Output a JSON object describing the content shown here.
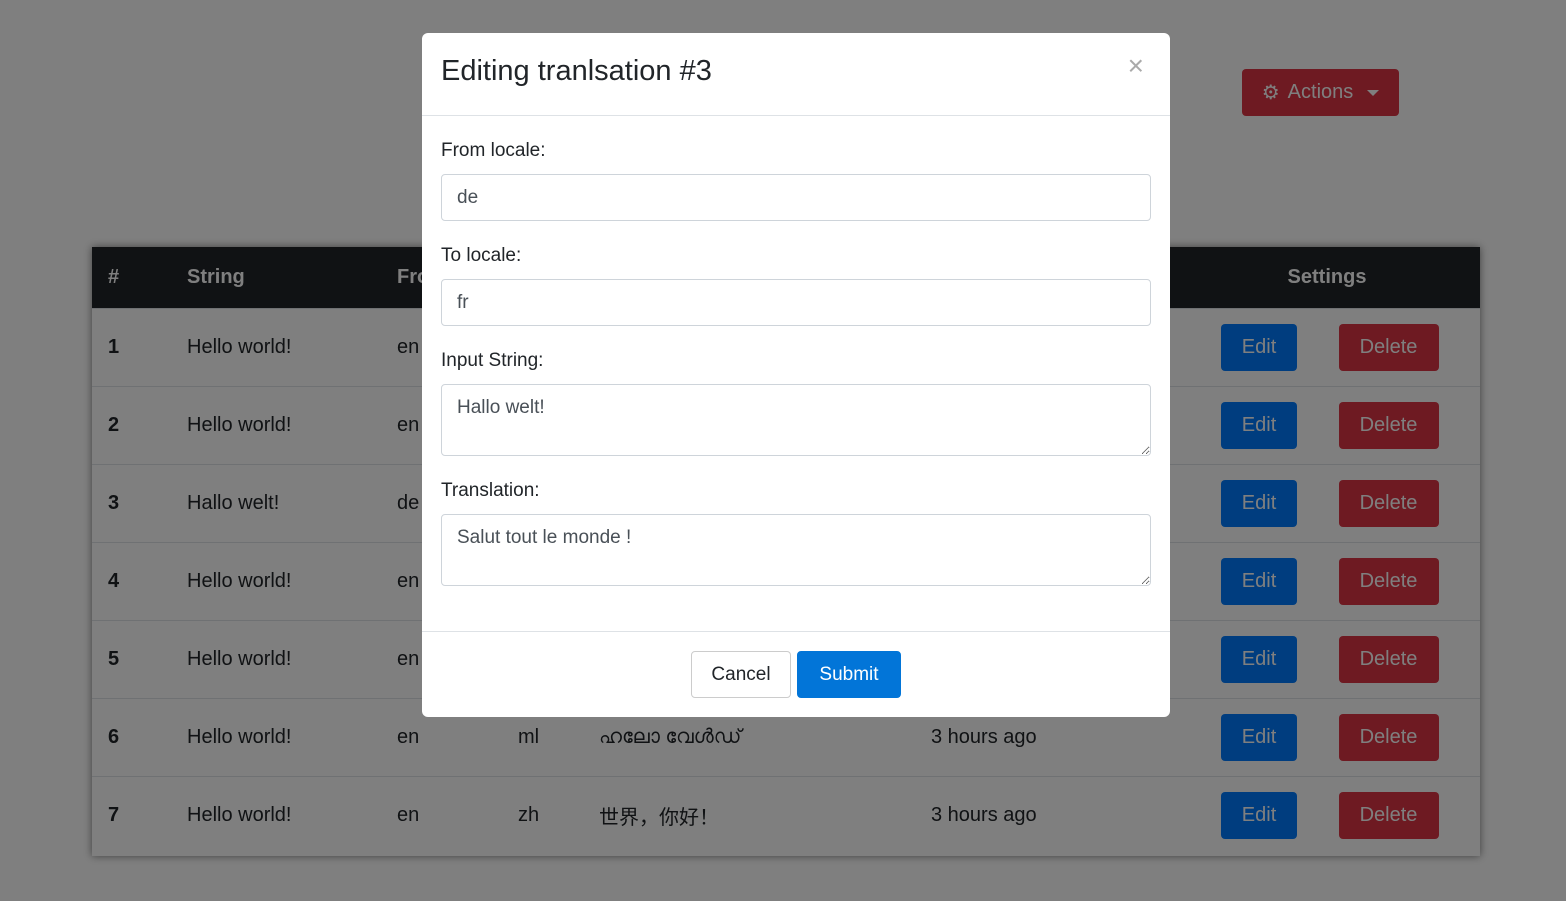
{
  "toolbar": {
    "actions_label": "Actions",
    "actions_icon": "gear-icon",
    "actions_color": "#dc3545"
  },
  "table": {
    "headers": [
      "#",
      "String",
      "From",
      "",
      "",
      "",
      "Settings"
    ],
    "rows": [
      {
        "id": "1",
        "string": "Hello world!",
        "from": "en",
        "to": "",
        "translation": "",
        "time": "",
        "edit": "Edit",
        "delete": "Delete"
      },
      {
        "id": "2",
        "string": "Hello world!",
        "from": "en",
        "to": "",
        "translation": "",
        "time": "",
        "edit": "Edit",
        "delete": "Delete"
      },
      {
        "id": "3",
        "string": "Hallo welt!",
        "from": "de",
        "to": "",
        "translation": "",
        "time": "",
        "edit": "Edit",
        "delete": "Delete"
      },
      {
        "id": "4",
        "string": "Hello world!",
        "from": "en",
        "to": "",
        "translation": "",
        "time": "",
        "edit": "Edit",
        "delete": "Delete"
      },
      {
        "id": "5",
        "string": "Hello world!",
        "from": "en",
        "to": "",
        "translation": "",
        "time": "",
        "edit": "Edit",
        "delete": "Delete"
      },
      {
        "id": "6",
        "string": "Hello world!",
        "from": "en",
        "to": "ml",
        "translation": "ഹലോ വേൾഡ്",
        "time": "3 hours ago",
        "edit": "Edit",
        "delete": "Delete"
      },
      {
        "id": "7",
        "string": "Hello world!",
        "from": "en",
        "to": "zh",
        "translation": "世界，你好！",
        "time": "3 hours ago",
        "edit": "Edit",
        "delete": "Delete"
      }
    ]
  },
  "modal": {
    "title": "Editing tranlsation #3",
    "close_symbol": "×",
    "fields": {
      "from_locale_label": "From locale:",
      "from_locale_value": "de",
      "to_locale_label": "To locale:",
      "to_locale_value": "fr",
      "input_string_label": "Input String:",
      "input_string_value": "Hallo welt!",
      "translation_label": "Translation:",
      "translation_value": "Salut tout le monde !"
    },
    "cancel_label": "Cancel",
    "submit_label": "Submit"
  },
  "colors": {
    "primary": "#007bff",
    "danger": "#dc3545",
    "submit": "#0275d8",
    "table_header": "#212529"
  }
}
